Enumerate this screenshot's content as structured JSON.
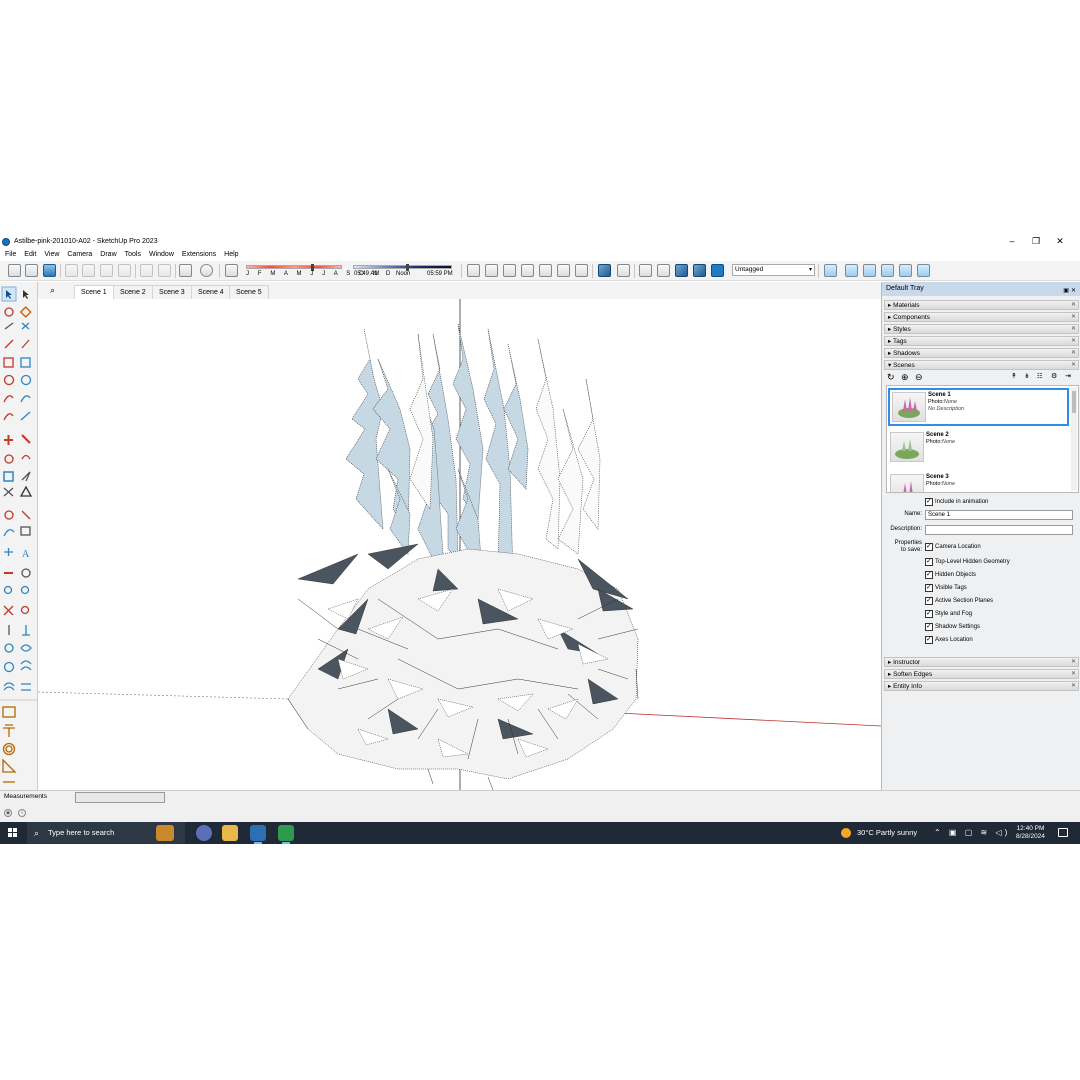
{
  "window": {
    "title": "Astilbe-pink-201010-A02 - SketchUp Pro 2023",
    "controls": {
      "minimize": "–",
      "maximize": "❐",
      "close": "✕"
    }
  },
  "menu": [
    "File",
    "Edit",
    "View",
    "Camera",
    "Draw",
    "Tools",
    "Window",
    "Extensions",
    "Help"
  ],
  "toolbar": {
    "months": "J F M A M J J A S O N D",
    "time_start": "05:49 AM",
    "time_mid": "Noon",
    "time_end": "05:59 PM",
    "tag_selector": "Untagged"
  },
  "scene_tabs": [
    "Scene 1",
    "Scene 2",
    "Scene 3",
    "Scene 4",
    "Scene 5"
  ],
  "tray": {
    "title": "Default Tray",
    "panels_top": [
      "Materials",
      "Components",
      "Styles",
      "Tags",
      "Shadows"
    ],
    "scenes_panel": "Scenes",
    "scenes": [
      {
        "name": "Scene 1",
        "photo_label": "Photo:",
        "photo_value": "None",
        "description": "No Description"
      },
      {
        "name": "Scene 2",
        "photo_label": "Photo:",
        "photo_value": "None"
      },
      {
        "name": "Scene 3",
        "photo_label": "Photo:",
        "photo_value": "None"
      }
    ],
    "include_in_animation": "Include in animation",
    "name_label": "Name:",
    "name_value": "Scene 1",
    "description_label": "Description:",
    "description_value": "",
    "properties_label_1": "Properties",
    "properties_label_2": "to save:",
    "properties": [
      "Camera Location",
      "Top-Level Hidden Geometry",
      "Hidden Objects",
      "Visible Tags",
      "Active Section Planes",
      "Style and Fog",
      "Shadow Settings",
      "Axes Location"
    ],
    "panels_bottom": [
      "Instructor",
      "Soften Edges",
      "Entity Info"
    ]
  },
  "status": {
    "measurements_label": "Measurements",
    "measurements_value": ""
  },
  "taskbar": {
    "search_placeholder": "Type here to search",
    "weather": "30°C  Partly sunny",
    "time": "12:40 PM",
    "date": "8/28/2024"
  },
  "colors": {
    "taskbar": "#1f2a36",
    "tray_header": "#c9d9ec",
    "selection": "#2e8de8",
    "axis_red": "#c0302a"
  }
}
